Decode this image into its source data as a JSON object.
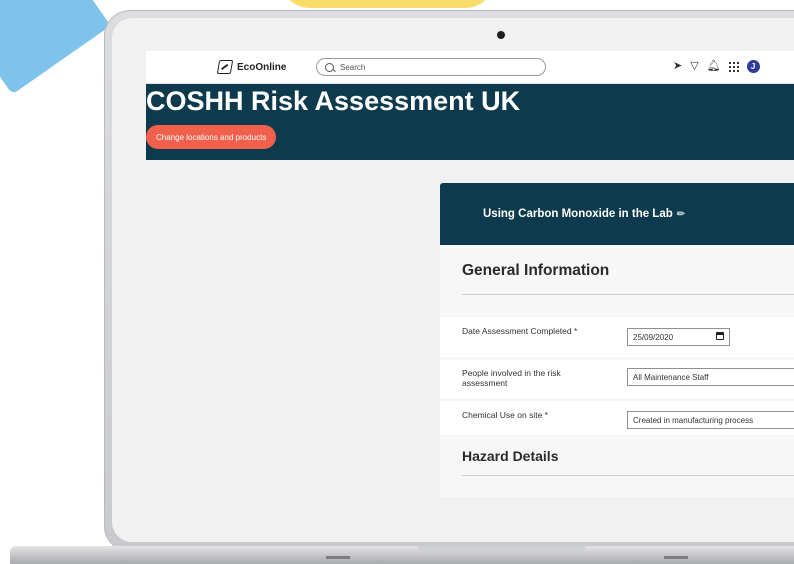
{
  "nav": {
    "logo_text": "EcoOnline",
    "search_placeholder": "Search",
    "avatar_initial": "J"
  },
  "banner": {
    "title": "COSHH Risk Assessment UK",
    "change_button_label": "Change locations and products"
  },
  "card": {
    "title": "Using Carbon Monoxide in the Lab",
    "general_information_heading": "General Information",
    "fields": [
      {
        "label": "Date Assessment Completed *",
        "value": "25/09/2020"
      },
      {
        "label": "People involved in the risk assessment",
        "value": "All Maintenance Staff"
      },
      {
        "label": "Chemical Use on site *",
        "value": "Created in manufacturing process"
      }
    ],
    "hazard_details_heading": "Hazard Details"
  },
  "colors": {
    "banner": "#0e3a4d",
    "accent_button": "#f1604d",
    "avatar": "#2e3a9c"
  }
}
